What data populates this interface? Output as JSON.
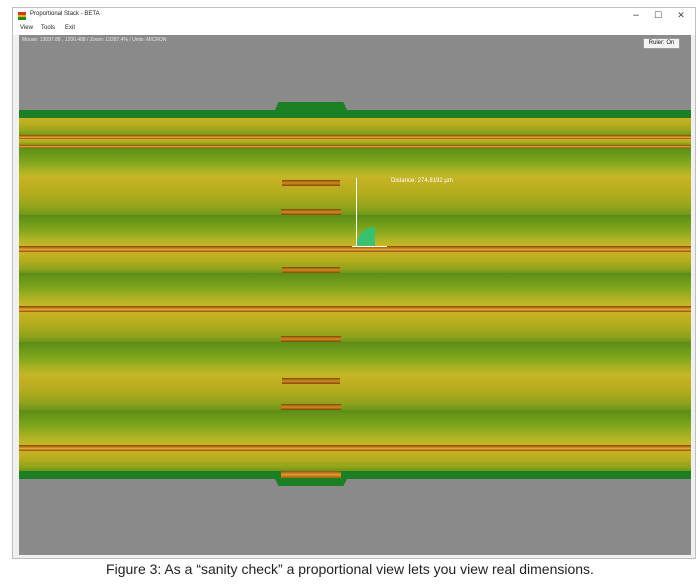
{
  "window": {
    "title": "Proportional Stack - BETA",
    "controls": {
      "minimize": "−",
      "maximize": "☐",
      "close": "✕"
    }
  },
  "menu": {
    "items": [
      "View",
      "Tools",
      "Exit"
    ]
  },
  "status_bar": {
    "text": "Mouse: 13097.88 , 1200.488  /  Zoom: 13287.4%  /  Units: MICRON"
  },
  "ruler_button": {
    "label": "Ruler: On"
  },
  "measurement": {
    "label": "Distance: 274.8192 µm"
  },
  "caption": "Figure 3: As a “sanity check” a proportional view lets you view real dimensions.",
  "colors": {
    "canvas_background": "#8a8a8a",
    "solder_mask": "#1d7f24",
    "copper": "#d78a1e",
    "dielectric": "#9fae20",
    "measure_arc": "#2ec27a"
  },
  "icons": {
    "app": "stack-layers-icon"
  }
}
